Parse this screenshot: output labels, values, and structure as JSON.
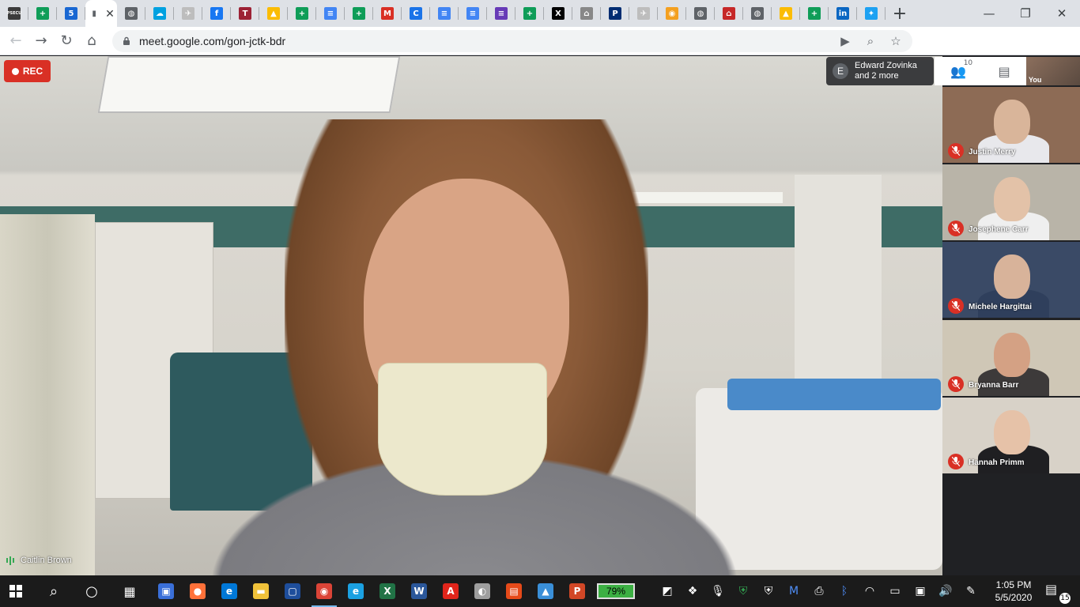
{
  "browser": {
    "url": "meet.google.com/gon-jctk-bdr",
    "tabs": [
      {
        "icon": "psecu-icon",
        "glyph": "PSECU",
        "color": "#3b3b3b"
      },
      {
        "icon": "sheets-icon",
        "glyph": "+",
        "color": "#0f9d58"
      },
      {
        "icon": "calendar-icon",
        "glyph": "5",
        "color": "#1967d2"
      },
      {
        "icon": "meet-icon",
        "glyph": "▮",
        "color": "#ffffff",
        "active": true
      },
      {
        "icon": "globe-icon",
        "glyph": "◍",
        "color": "#5f6368"
      },
      {
        "icon": "salesforce-icon",
        "glyph": "☁",
        "color": "#00a1e0"
      },
      {
        "icon": "bird-icon",
        "glyph": "✈",
        "color": "#bdbdbd"
      },
      {
        "icon": "facebook-icon",
        "glyph": "f",
        "color": "#1877f2"
      },
      {
        "icon": "temple-icon",
        "glyph": "T",
        "color": "#9d2235"
      },
      {
        "icon": "drive-icon",
        "glyph": "▲",
        "color": "#fbbc04"
      },
      {
        "icon": "sheets-icon",
        "glyph": "+",
        "color": "#0f9d58"
      },
      {
        "icon": "docs-icon",
        "glyph": "≡",
        "color": "#4285f4"
      },
      {
        "icon": "sheets-icon",
        "glyph": "+",
        "color": "#0f9d58"
      },
      {
        "icon": "gmail-icon",
        "glyph": "M",
        "color": "#d93025"
      },
      {
        "icon": "classroom-icon",
        "glyph": "C",
        "color": "#1a73e8"
      },
      {
        "icon": "docs-icon",
        "glyph": "≡",
        "color": "#4285f4"
      },
      {
        "icon": "docs-icon",
        "glyph": "≡",
        "color": "#4285f4"
      },
      {
        "icon": "forms-icon",
        "glyph": "≡",
        "color": "#673ab7"
      },
      {
        "icon": "sheets-icon",
        "glyph": "+",
        "color": "#0f9d58"
      },
      {
        "icon": "x-icon",
        "glyph": "X",
        "color": "#000000"
      },
      {
        "icon": "building-icon",
        "glyph": "⌂",
        "color": "#888888"
      },
      {
        "icon": "p-icon",
        "glyph": "P",
        "color": "#002d72"
      },
      {
        "icon": "bird-icon",
        "glyph": "✈",
        "color": "#bdbdbd"
      },
      {
        "icon": "seal-icon",
        "glyph": "◉",
        "color": "#f4a020"
      },
      {
        "icon": "globe-icon",
        "glyph": "◍",
        "color": "#5f6368"
      },
      {
        "icon": "home-icon",
        "glyph": "⌂",
        "color": "#c62828"
      },
      {
        "icon": "globe-icon",
        "glyph": "◍",
        "color": "#5f6368"
      },
      {
        "icon": "drive-icon",
        "glyph": "▲",
        "color": "#fbbc04"
      },
      {
        "icon": "sheets-icon",
        "glyph": "+",
        "color": "#0f9d58"
      },
      {
        "icon": "linkedin-icon",
        "glyph": "in",
        "color": "#0a66c2"
      },
      {
        "icon": "twitter-icon",
        "glyph": "✦",
        "color": "#1da1f2"
      }
    ]
  },
  "meet": {
    "rec_label": "REC",
    "speaker_name": "Caitlin Brown",
    "participants_chip": {
      "initial": "E",
      "line1": "Edward Zovinka",
      "line2": "and 2 more"
    },
    "participant_count": "10",
    "self_label": "You",
    "tiles": [
      {
        "name": "Justin Merry",
        "bg": "#8d6b55",
        "skin": "#d9b59a",
        "shirt": "#e8e8ec"
      },
      {
        "name": "Josephene Carr",
        "bg": "#b9b4a8",
        "skin": "#e3c2a8",
        "shirt": "#efefef"
      },
      {
        "name": "Michele Hargittai",
        "bg": "#3a4a66",
        "skin": "#d8b39a",
        "shirt": "#2f3f5c"
      },
      {
        "name": "Bryanna Barr",
        "bg": "#cfc7b6",
        "skin": "#d4a184",
        "shirt": "#3d3a3a"
      },
      {
        "name": "Hannah Primm",
        "bg": "#d8d2c8",
        "skin": "#e6c2a8",
        "shirt": "#1f1f22"
      }
    ]
  },
  "taskbar": {
    "battery": "79%",
    "time": "1:05 PM",
    "date": "5/5/2020",
    "notifications": "15",
    "apps": [
      {
        "icon": "task-view-computer-icon",
        "glyph": "▣",
        "color": "#3a6fd8"
      },
      {
        "icon": "firefox-icon",
        "glyph": "●",
        "color": "#ff7139"
      },
      {
        "icon": "edge-icon",
        "glyph": "e",
        "color": "#0078d7"
      },
      {
        "icon": "file-explorer-icon",
        "glyph": "▬",
        "color": "#f0c23a"
      },
      {
        "icon": "terminal-icon",
        "glyph": "▢",
        "color": "#1e4e9c"
      },
      {
        "icon": "chrome-icon",
        "glyph": "◉",
        "color": "#db4437",
        "running": true
      },
      {
        "icon": "internet-explorer-icon",
        "glyph": "e",
        "color": "#1ba1e2"
      },
      {
        "icon": "excel-icon",
        "glyph": "X",
        "color": "#217346"
      },
      {
        "icon": "word-icon",
        "glyph": "W",
        "color": "#2b579a"
      },
      {
        "icon": "acrobat-icon",
        "glyph": "A",
        "color": "#e1251b"
      },
      {
        "icon": "paint-icon",
        "glyph": "◐",
        "color": "#9e9e9e"
      },
      {
        "icon": "app-icon",
        "glyph": "▤",
        "color": "#e64a19"
      },
      {
        "icon": "photos-icon",
        "glyph": "▲",
        "color": "#3a8fd8"
      },
      {
        "icon": "powerpoint-icon",
        "glyph": "P",
        "color": "#d24726"
      }
    ]
  }
}
